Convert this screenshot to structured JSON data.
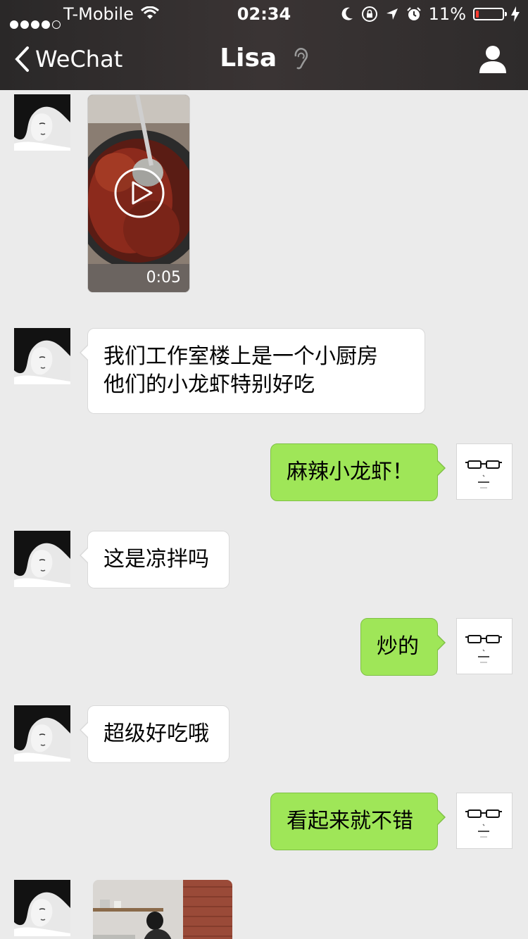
{
  "status_bar": {
    "carrier": "T-Mobile",
    "time": "02:34",
    "battery_percent": "11%",
    "battery_level": 0.11,
    "battery_color": "#ff3b30"
  },
  "nav": {
    "back_label": "WeChat",
    "title": "Lisa",
    "title_icon": "ear-icon",
    "right_icon": "profile-icon"
  },
  "colors": {
    "incoming_bubble": "#ffffff",
    "outgoing_bubble": "#9fe658",
    "chat_background": "#ebebeb"
  },
  "messages": [
    {
      "from": "Lisa",
      "type": "video",
      "duration": "0:05"
    },
    {
      "from": "Lisa",
      "type": "text",
      "lines": [
        "我们工作室楼上是一个小厨房",
        "他们的小龙虾特别好吃"
      ]
    },
    {
      "from": "me",
      "type": "text",
      "lines": [
        "麻辣小龙虾！"
      ]
    },
    {
      "from": "Lisa",
      "type": "text",
      "lines": [
        "这是凉拌吗"
      ]
    },
    {
      "from": "me",
      "type": "text",
      "lines": [
        "炒的"
      ]
    },
    {
      "from": "Lisa",
      "type": "text",
      "lines": [
        "超级好吃哦"
      ]
    },
    {
      "from": "me",
      "type": "text",
      "lines": [
        "看起来就不错"
      ]
    },
    {
      "from": "Lisa",
      "type": "image"
    }
  ]
}
